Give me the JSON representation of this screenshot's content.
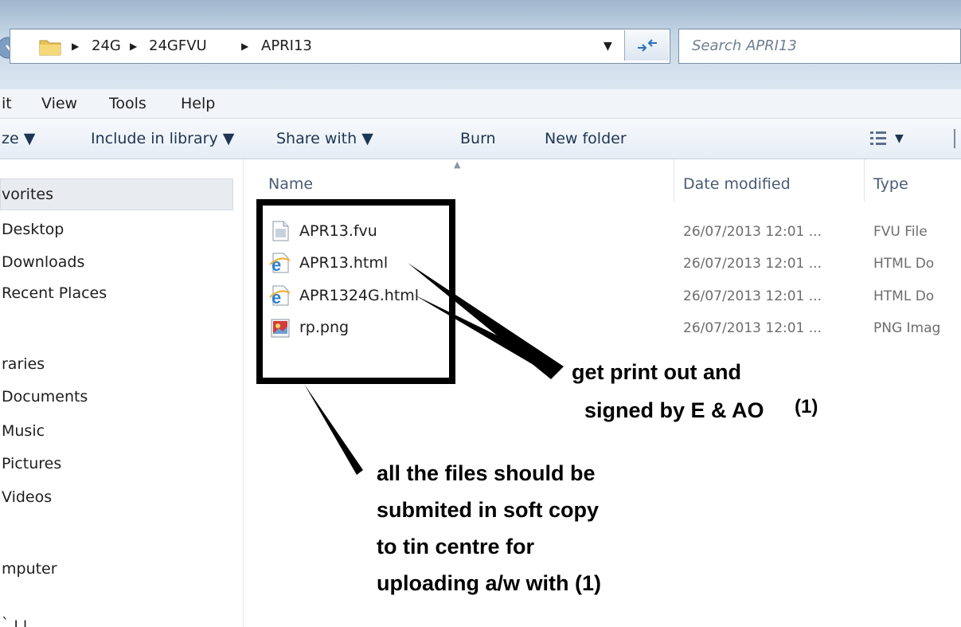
{
  "address": {
    "crumbs": [
      "24G",
      "24GFVU",
      "APRI13"
    ],
    "search_placeholder": "Search APRI13"
  },
  "menu": [
    "it",
    "View",
    "Tools",
    "Help"
  ],
  "toolbar": {
    "organize": "ze ▼",
    "include": "Include in library ▼",
    "share": "Share with ▼",
    "burn": "Burn",
    "new_folder": "New folder",
    "views": "▼"
  },
  "nav": {
    "items": [
      "vorites",
      "Desktop",
      "Downloads",
      "Recent Places",
      "raries",
      "Documents",
      "Music",
      "Pictures",
      "Videos",
      "mputer"
    ]
  },
  "columns": {
    "name": "Name",
    "date": "Date modified",
    "type": "Type"
  },
  "files": [
    {
      "name": "APR13.fvu",
      "date": "26/07/2013 12:01 ...",
      "type": "FVU File",
      "icon": "generic-file-icon"
    },
    {
      "name": "APR13.html",
      "date": "26/07/2013 12:01 ...",
      "type": "HTML Do",
      "icon": "ie-html-icon"
    },
    {
      "name": "APR1324G.html",
      "date": "26/07/2013 12:01 ...",
      "type": "HTML Do",
      "icon": "ie-html-icon"
    },
    {
      "name": "rp.png",
      "date": "26/07/2013 12:01 ...",
      "type": "PNG Imag",
      "icon": "image-file-icon"
    }
  ],
  "annotations": {
    "note1": [
      "get print out and",
      "signed by E & AO"
    ],
    "note1_ref": "(1)",
    "note2": [
      "all the files should be",
      "submited in soft copy",
      "to tin centre for",
      "uploading a/w with (1)"
    ]
  },
  "colors": {
    "address_gradient_top": "#9fb6cd",
    "toolbar_text": "#1e3553",
    "annotation": "#000000",
    "ie_blue": "#2d7fd3"
  }
}
